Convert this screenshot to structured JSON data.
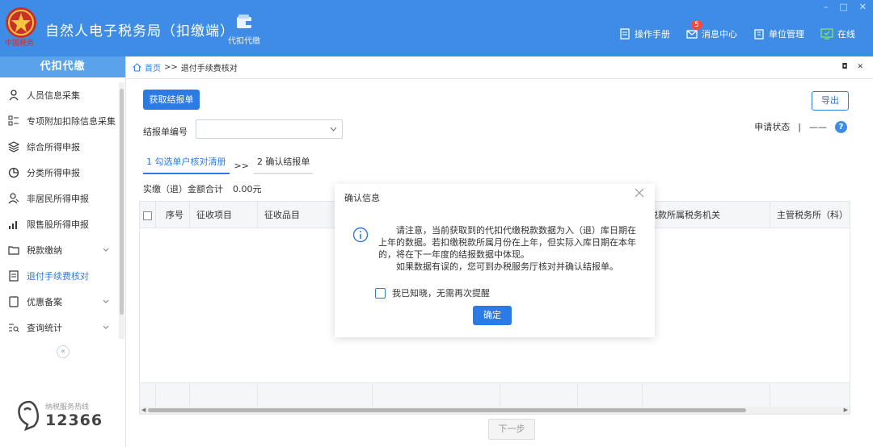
{
  "titlebar": {
    "logo_text": "中国税务",
    "app_title": "自然人电子税务局（扣缴端）",
    "nav_item": "代扣代缴",
    "window_controls": [
      "–",
      "□",
      "✕"
    ],
    "manual": "操作手册",
    "messages": "消息中心",
    "message_count": "5",
    "unit_mgmt": "单位管理",
    "online": "在线"
  },
  "sidebar": {
    "header": "代扣代缴",
    "items": [
      {
        "label": "人员信息采集",
        "icon": "person-icon"
      },
      {
        "label": "专项附加扣除信息采集",
        "icon": "list-icon"
      },
      {
        "label": "综合所得申报",
        "icon": "layers-icon"
      },
      {
        "label": "分类所得申报",
        "icon": "pie-icon"
      },
      {
        "label": "非居民所得申报",
        "icon": "person-outline-icon"
      },
      {
        "label": "限售股所得申报",
        "icon": "bar-chart-icon"
      },
      {
        "label": "税款缴纳",
        "icon": "folder-icon"
      },
      {
        "label": "退付手续费核对",
        "icon": "document-icon"
      },
      {
        "label": "优惠备案",
        "icon": "note-icon"
      },
      {
        "label": "查询统计",
        "icon": "search-list-icon"
      }
    ],
    "collapse_glyph": "«",
    "hotline_label": "纳税服务热线",
    "hotline_number": "12366"
  },
  "breadcrumb": {
    "home": "首页",
    "sep": ">>",
    "current": "退付手续费核对",
    "ctl1": "◘",
    "ctl2": "✕"
  },
  "main": {
    "fetch_button": "获取结报单",
    "export_button": "导出",
    "report_no_label": "结报单编号",
    "status_label": "申请状态",
    "status_sep": "|",
    "status_value": "——",
    "help": "?",
    "step1": "1 勾选单户核对清册",
    "step_arrow": ">>",
    "step2": "2 确认结报单",
    "total_label": "实缴（退）金额合计",
    "total_value": "0.00元",
    "columns": [
      "序号",
      "征收项目",
      "征收品目",
      "",
      "",
      "",
      "",
      "税款所属税务机关",
      "主管税务所（科）"
    ],
    "next_button": "下一步"
  },
  "dialog": {
    "title": "确认信息",
    "para1": "请注意，当前获取到的代扣代缴税款数据为入（退）库日期在上年的数据。若扣缴税款所属月份在上年，但实际入库日期在本年的，将在下一年度的结报数据中体现。",
    "para2": "如果数据有误的，您可到办税服务厅核对并确认结报单。",
    "checkbox_label": "我已知晓，无需再次提醒",
    "ok_button": "确定"
  },
  "colors": {
    "brand": "#3f8ce6",
    "primary": "#2c7be5"
  }
}
